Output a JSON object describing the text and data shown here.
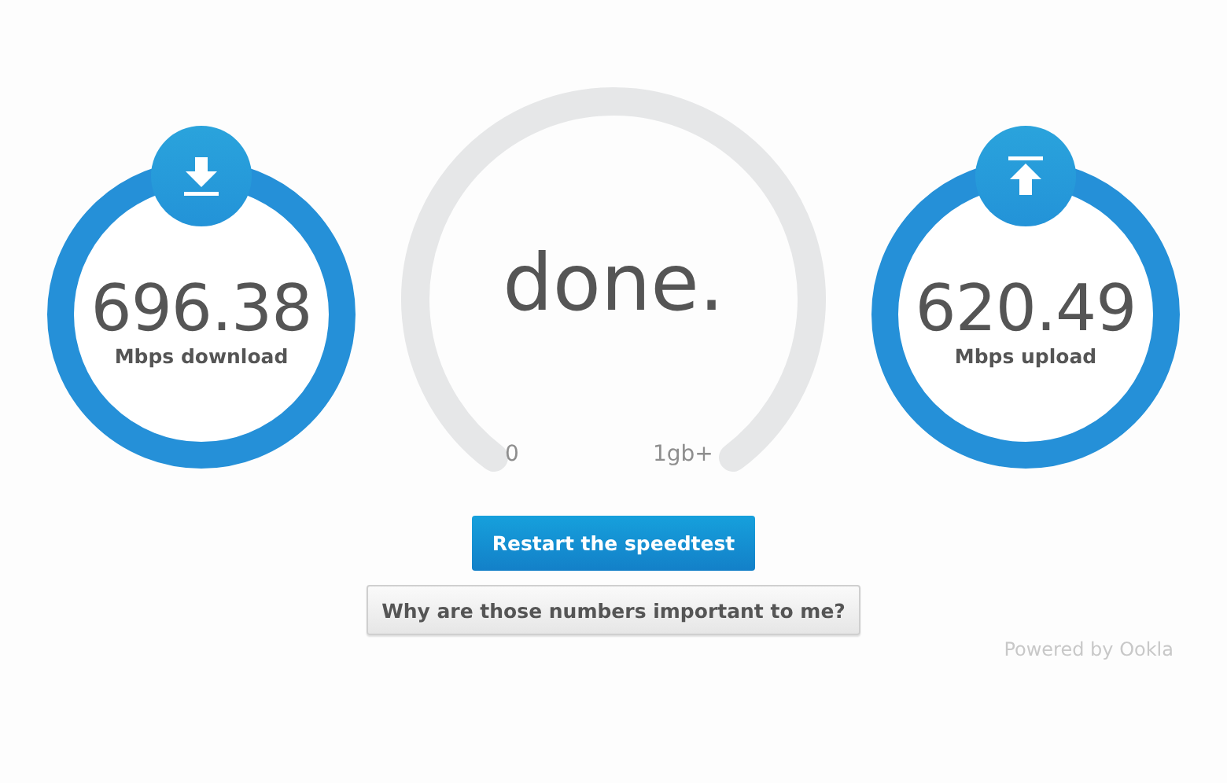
{
  "meters": [
    {
      "kind": "download",
      "value": "696.38",
      "label": "Mbps download"
    },
    {
      "kind": "gauge",
      "status": "done.",
      "min_label": "0",
      "max_label": "1gb+"
    },
    {
      "kind": "upload",
      "value": "620.49",
      "label": "Mbps upload"
    }
  ],
  "buttons": [
    {
      "kind": "primary",
      "label": "Restart the speedtest"
    },
    {
      "kind": "secondary",
      "label": "Why are those numbers important to me?"
    }
  ],
  "footer": "Powered by Ookla"
}
